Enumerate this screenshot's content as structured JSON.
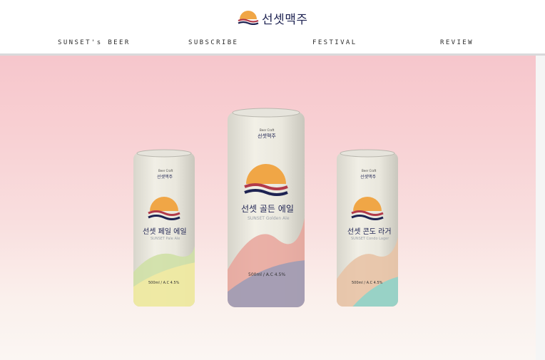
{
  "brand": {
    "logo_text": "선셋맥주",
    "colors": {
      "sun": "#f0a646",
      "wave_red": "#b23a4a",
      "wave_navy": "#1e2352",
      "hero_top": "#f6c6cc",
      "hero_bottom": "#fbf6f3"
    }
  },
  "nav": {
    "items": [
      {
        "label": "SUNSET's BEER"
      },
      {
        "label": "SUBSCRIBE"
      },
      {
        "label": "FESTIVAL"
      },
      {
        "label": "REVIEW"
      }
    ]
  },
  "cans": [
    {
      "brand_small": "Beer Craft",
      "brand_logo": "선셋맥주",
      "name_ko": "선셋 페일 에일",
      "name_en": "SUNSET Pale Ale",
      "volume": "500ml / A.C 4.5%",
      "accent_colors": [
        "#cfe0a6",
        "#f3eaa2"
      ]
    },
    {
      "brand_small": "Beer Craft",
      "brand_logo": "선셋맥주",
      "name_ko": "선셋 골든 에일",
      "name_en": "SUNSET Golden Ale",
      "volume": "500ml / A.C 4.5%",
      "accent_colors": [
        "#e9a59b",
        "#9a9bb6"
      ]
    },
    {
      "brand_small": "Beer Craft",
      "brand_logo": "선셋맥주",
      "name_ko": "선셋 콘도 라거",
      "name_en": "SUNSET Condo Lager",
      "volume": "500ml / A.C 4.5%",
      "accent_colors": [
        "#e8c3a6",
        "#8fd3c9"
      ]
    }
  ]
}
